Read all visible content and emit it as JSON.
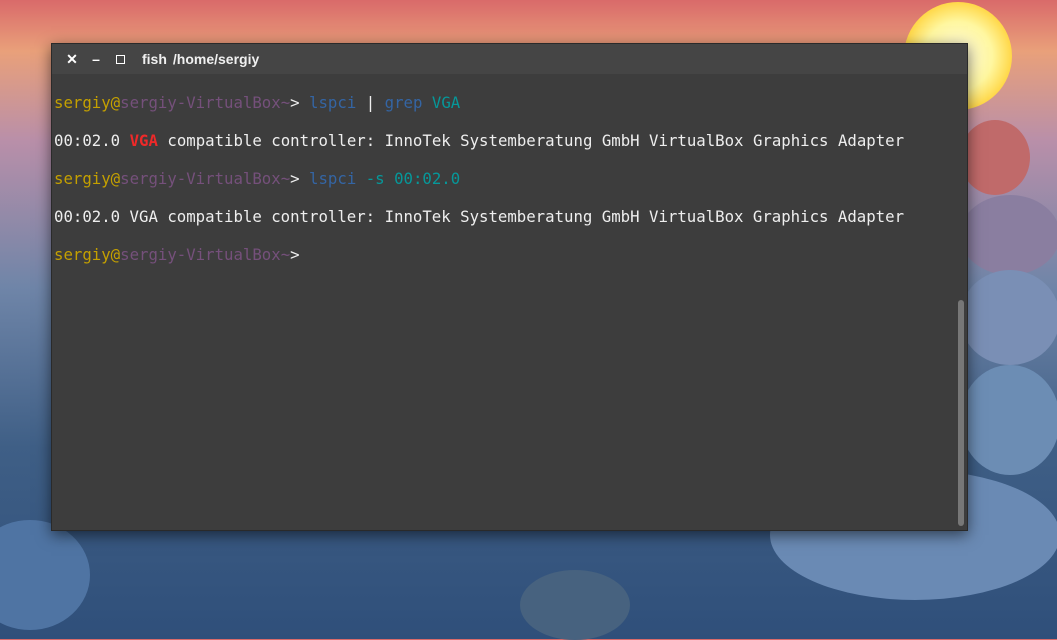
{
  "window": {
    "title_app": "fish",
    "title_path": "/home/sergiy"
  },
  "prompt": {
    "user": "sergiy",
    "at": "@",
    "host": "sergiy-VirtualBox",
    "path": "~",
    "symbol": ">"
  },
  "lines": [
    {
      "cmd": "lspci",
      "pipe": "|",
      "cmd2": "grep",
      "arg": "VGA"
    },
    {
      "addr": "00:02.0",
      "match": "VGA",
      "rest": "compatible controller: InnoTek Systemberatung GmbH VirtualBox Graphics Adapter"
    },
    {
      "cmd": "lspci",
      "arg": "-s 00:02.0"
    },
    {
      "text": "00:02.0 VGA compatible controller: InnoTek Systemberatung GmbH VirtualBox Graphics Adapter"
    }
  ],
  "colors": {
    "terminal_bg": "#3d3d3d",
    "prompt_user": "#c4a000",
    "prompt_host": "#75507b",
    "command": "#3465a4",
    "argument": "#06989a",
    "match_highlight": "#ef2929"
  }
}
